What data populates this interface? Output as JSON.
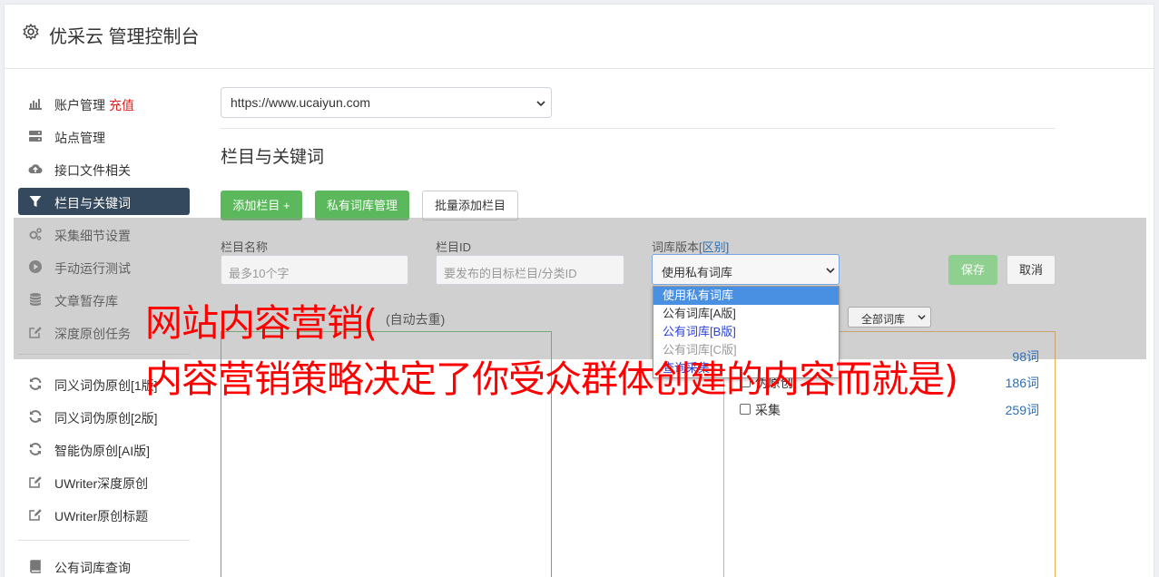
{
  "header": {
    "title": "优采云 管理控制台"
  },
  "sidebar": {
    "items": [
      {
        "label": "账户管理",
        "tag": "充值",
        "icon": "bar-chart-icon"
      },
      {
        "label": "站点管理",
        "icon": "server-icon"
      },
      {
        "label": "接口文件相关",
        "icon": "cloud-upload-icon"
      },
      {
        "label": "栏目与关键词",
        "icon": "filter-icon",
        "active": true
      },
      {
        "label": "采集细节设置",
        "icon": "cogs-icon"
      },
      {
        "label": "手动运行测试",
        "icon": "play-circle-icon"
      },
      {
        "label": "文章暂存库",
        "icon": "database-icon"
      },
      {
        "label": "深度原创任务",
        "icon": "edit-icon"
      },
      {
        "label": "同义词伪原创[1版]",
        "icon": "refresh-icon"
      },
      {
        "label": "同义词伪原创[2版]",
        "icon": "refresh-icon"
      },
      {
        "label": "智能伪原创[AI版]",
        "icon": "refresh-icon"
      },
      {
        "label": "UWriter深度原创",
        "icon": "edit-icon"
      },
      {
        "label": "UWriter原创标题",
        "icon": "edit-icon"
      },
      {
        "label": "公有词库查询",
        "icon": "book-icon"
      }
    ]
  },
  "site_select": {
    "value": "https://www.ucaiyun.com"
  },
  "section": {
    "title": "栏目与关键词"
  },
  "actions": {
    "add_column": "添加栏目 +",
    "private_lexicon": "私有词库管理",
    "batch_add": "批量添加栏目"
  },
  "form": {
    "name_label": "栏目名称",
    "name_placeholder": "最多10个字",
    "id_label": "栏目ID",
    "id_placeholder": "要发布的目标栏目/分类ID",
    "lexicon_label": "词库版本",
    "lexicon_link": "[区别]",
    "lexicon_value": "使用私有词库",
    "save": "保存",
    "cancel": "取消",
    "keywords_hint": "(自动去重)",
    "filter_value": "全部词库"
  },
  "dropdown": {
    "options": [
      "使用私有词库",
      "公有词库[A版]",
      "公有词库[B版]",
      "公有词库[C版]",
      "查询采集"
    ]
  },
  "lexicon_rows": [
    {
      "name": "",
      "count": "98词"
    },
    {
      "name": "伪原创",
      "count": "186词"
    },
    {
      "name": "采集",
      "count": "259词"
    }
  ],
  "watermark": {
    "line1": "网站内容营销(",
    "line2": "内容营销策略决定了你受众群体创建的内容而就是)"
  },
  "colors": {
    "accent_green": "#5cb85c",
    "active_nav": "#34495e",
    "watermark": "#ff0000"
  }
}
